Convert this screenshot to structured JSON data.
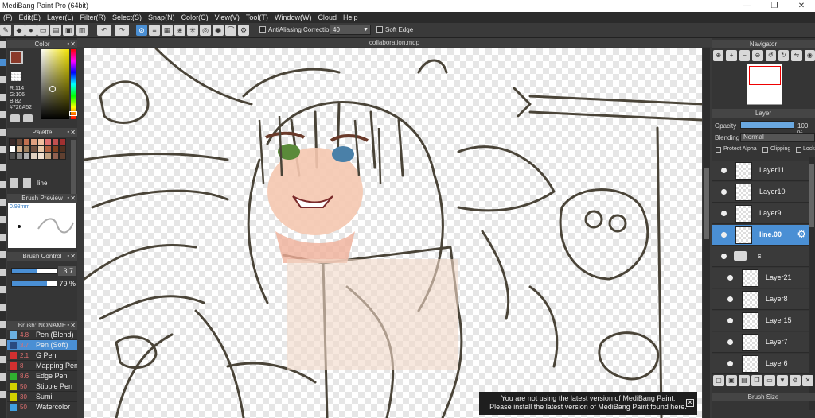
{
  "window": {
    "title": "MediBang Paint Pro (64bit)",
    "minimize": "—",
    "maximize": "❐",
    "close": "✕"
  },
  "menu": [
    "(F)",
    "Edit(E)",
    "Layer(L)",
    "Filter(R)",
    "Select(S)",
    "Snap(N)",
    "Color(C)",
    "View(V)",
    "Tool(T)",
    "Window(W)",
    "Cloud",
    "Help"
  ],
  "toolbar": {
    "antialiasing_label": "AntiAliasing",
    "correction_label": "Correction",
    "correction_value": "40",
    "soft_edge_label": "Soft Edge",
    "undo_icon": "undo-icon",
    "redo_icon": "redo-icon"
  },
  "color_panel": {
    "title": "Color",
    "r": "R:114",
    "g": "G:106",
    "b": "B:82",
    "hex": "#726A52",
    "foreground": "#8a3a2a",
    "background_swatch": "#e8a080"
  },
  "palette_panel": {
    "title": "Palette",
    "layer_name": "line",
    "colors": [
      "#3a2a2a",
      "#6a4a3a",
      "#c07050",
      "#e0a080",
      "#f0c0a0",
      "#e07070",
      "#c05050",
      "#a03030",
      "#ffffff",
      "#d0b090",
      "#a08060",
      "#705040",
      "#e8c8a8",
      "#b06040",
      "#804020",
      "#503020",
      "#505050",
      "#888888",
      "#b0b0b0",
      "#e0d0c0",
      "#f0e0d0",
      "#c0a080",
      "#906050",
      "#604030"
    ]
  },
  "brush_preview": {
    "title": "Brush Preview",
    "size": "0.98mm"
  },
  "brush_control": {
    "title": "Brush Control",
    "size_value": "3.7",
    "opacity_value": "79 %",
    "size_fraction": 0.55,
    "opacity_fraction": 0.79
  },
  "brush_list": {
    "title": "Brush: NONAME",
    "items": [
      {
        "size": "4.8",
        "name": "Pen (Blend)",
        "color": "#6ab0e0",
        "selected": false
      },
      {
        "size": "3.7",
        "name": "Pen (Soft)",
        "color": "#2a4a80",
        "selected": true
      },
      {
        "size": "2.1",
        "name": "G Pen",
        "color": "#d03030",
        "selected": false
      },
      {
        "size": "8",
        "name": "Mapping Pen",
        "color": "#d03030",
        "selected": false
      },
      {
        "size": "8.6",
        "name": "Edge Pen",
        "color": "#30b030",
        "selected": false
      },
      {
        "size": "50",
        "name": "Stipple Pen",
        "color": "#d0d000",
        "selected": false
      },
      {
        "size": "30",
        "name": "Sumi",
        "color": "#d0d000",
        "selected": false
      },
      {
        "size": "50",
        "name": "Watercolor",
        "color": "#40a0e0",
        "selected": false
      }
    ]
  },
  "document": {
    "tab_title": "collaboration.mdp"
  },
  "notice": {
    "line1": "You are not using the latest version of MediBang Paint.",
    "line2": "Please install the latest version of MediBang Paint found here."
  },
  "navigator": {
    "title": "Navigator"
  },
  "layer_panel": {
    "title": "Layer",
    "opacity_label": "Opacity",
    "opacity_value": "100 %",
    "blending_label": "Blending",
    "blending_value": "Normal",
    "protect_alpha_label": "Protect Alpha",
    "clipping_label": "Clipping",
    "lock_label": "Lock",
    "layers": [
      {
        "name": "Layer11",
        "type": "layer",
        "selected": false,
        "indent": 0
      },
      {
        "name": "Layer10",
        "type": "layer",
        "selected": false,
        "indent": 0
      },
      {
        "name": "Layer9",
        "type": "layer",
        "selected": false,
        "indent": 0
      },
      {
        "name": "line.00",
        "type": "layer",
        "selected": true,
        "indent": 0
      },
      {
        "name": "s",
        "type": "folder",
        "selected": false,
        "indent": 0
      },
      {
        "name": "Layer21",
        "type": "layer",
        "selected": false,
        "indent": 1
      },
      {
        "name": "Layer8",
        "type": "layer",
        "selected": false,
        "indent": 1
      },
      {
        "name": "Layer15",
        "type": "layer",
        "selected": false,
        "indent": 1
      },
      {
        "name": "Layer7",
        "type": "layer",
        "selected": false,
        "indent": 1
      },
      {
        "name": "Layer6",
        "type": "layer",
        "selected": false,
        "indent": 1
      }
    ]
  },
  "brush_size_panel": {
    "title": "Brush Size"
  }
}
